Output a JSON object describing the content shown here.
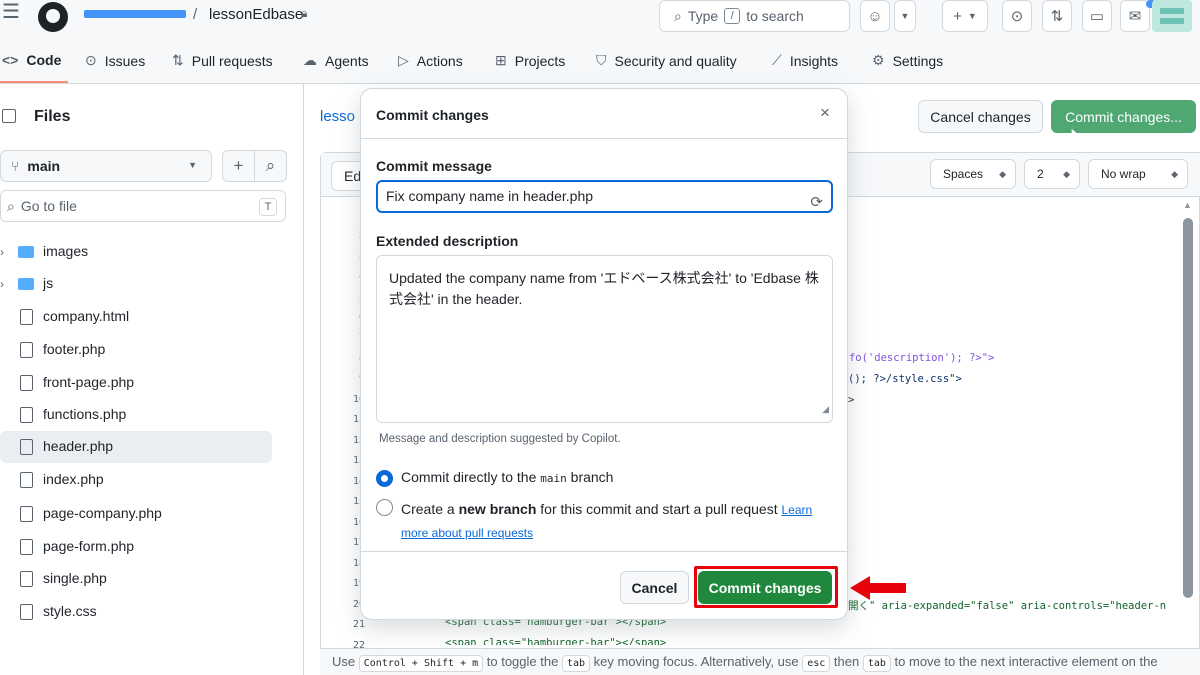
{
  "topbar": {
    "repo_name": "lessonEdbase",
    "slash": "/",
    "search_prefix": "Type",
    "search_key": "/",
    "search_suffix": "to search"
  },
  "nav": {
    "code": "Code",
    "issues": "Issues",
    "pull_requests": "Pull requests",
    "agents": "Agents",
    "actions": "Actions",
    "projects": "Projects",
    "security": "Security and quality",
    "insights": "Insights",
    "settings": "Settings"
  },
  "sidebar": {
    "title": "Files",
    "branch": "main",
    "goto_placeholder": "Go to file",
    "goto_key": "T",
    "items": [
      {
        "label": "images",
        "type": "folder"
      },
      {
        "label": "js",
        "type": "folder"
      },
      {
        "label": "company.html",
        "type": "file"
      },
      {
        "label": "footer.php",
        "type": "file"
      },
      {
        "label": "front-page.php",
        "type": "file"
      },
      {
        "label": "functions.php",
        "type": "file"
      },
      {
        "label": "header.php",
        "type": "file",
        "selected": true
      },
      {
        "label": "index.php",
        "type": "file"
      },
      {
        "label": "page-company.php",
        "type": "file"
      },
      {
        "label": "page-form.php",
        "type": "file"
      },
      {
        "label": "single.php",
        "type": "file"
      },
      {
        "label": "style.css",
        "type": "file"
      }
    ]
  },
  "main": {
    "crumb": "lesso",
    "cancel_label": "Cancel changes",
    "commit_label": "Commit changes...",
    "edit_tab": "Ed",
    "spaces": "Spaces",
    "indent": "2",
    "wrap": "No wrap",
    "line_numbers": [
      "1",
      "2",
      "3",
      "4",
      "5",
      "6",
      "7",
      "8",
      "9",
      "10",
      "11",
      "12",
      "13",
      "14",
      "15",
      "16",
      "17",
      "18",
      "19",
      "20",
      "21",
      "22"
    ],
    "code_8": "ginfo('description'); ?>\">",
    "code_9": "(); ?>/style.css\">",
    "code_10": ">",
    "code_20": "開く\" aria-expanded=\"false\" aria-controls=\"header-n",
    "code_21": "<span class=\"hamburger-bar\"></span>",
    "code_22": "<span class=\"hamburger-bar\"></span>",
    "footer_prefix": "Use",
    "footer_key1": "Control + Shift + m",
    "footer_mid1": "to toggle the",
    "footer_key2": "tab",
    "footer_mid2": "key moving focus. Alternatively, use",
    "footer_key3": "esc",
    "footer_mid3": "then",
    "footer_key4": "tab",
    "footer_suffix": "to move to the next interactive element on the"
  },
  "modal": {
    "title": "Commit changes",
    "close": "×",
    "message_label": "Commit message",
    "message_value": "Fix company name in header.php",
    "description_label": "Extended description",
    "description_value": "Updated the company name from 'エドベース株式会社' to 'Edbase 株式会社' in the header.",
    "copilot_hint": "Message and description suggested by Copilot.",
    "radio_direct_prefix": "Commit directly to the",
    "radio_direct_branch": "main",
    "radio_direct_suffix": "branch",
    "radio_new_prefix": "Create a",
    "radio_new_bold": "new branch",
    "radio_new_suffix": "for this commit and start a pull request",
    "learn_more": "Learn more about pull requests",
    "cancel": "Cancel",
    "commit": "Commit changes"
  },
  "colors": {
    "primary_green": "#1f883d",
    "accent_blue": "#0969da",
    "annotation_red": "#e8000b"
  }
}
